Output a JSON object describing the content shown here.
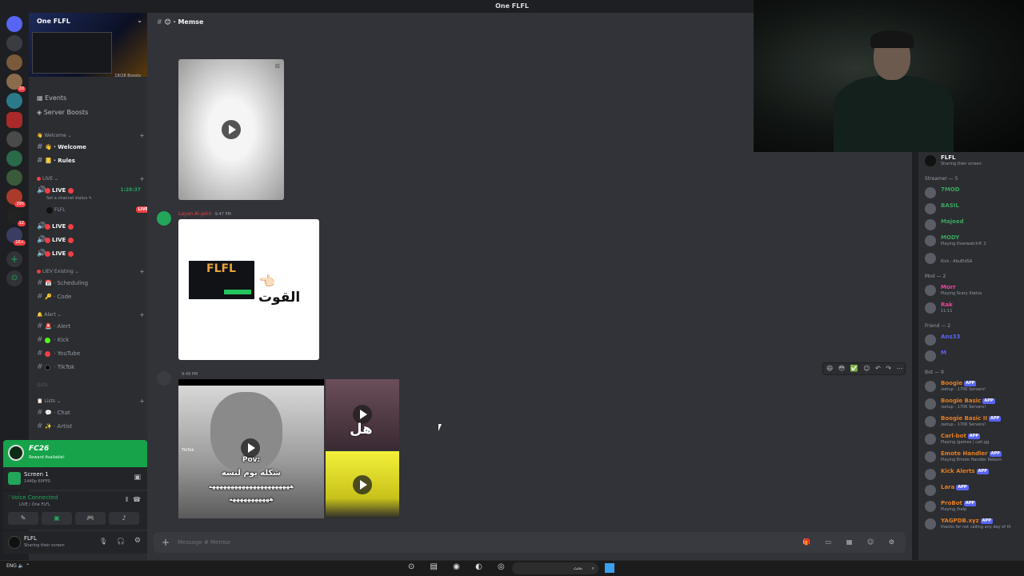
{
  "window": {
    "title": "One FLFL"
  },
  "guild_badges": [
    "",
    "",
    "20",
    "",
    "",
    "",
    "",
    "",
    "",
    "",
    "395",
    "12",
    "1K+"
  ],
  "server": {
    "name": "One FLFL",
    "boosts": "18/28 Boosts",
    "nav": [
      {
        "label": "Events",
        "icon": "calendar-icon"
      },
      {
        "label": "Server Boosts",
        "icon": "boost-icon"
      }
    ],
    "categories": {
      "welcome": "Welcome",
      "live": "LIVE",
      "liev_existing": "LIEV Existing",
      "alert": "Alert",
      "lists": "Lists",
      "girls": "Girls"
    },
    "channels": {
      "welcome": "Welcome",
      "rules": "Rules",
      "live_main": "LIVE",
      "live_status": "Set a channel status",
      "live_timer": "1:28:37",
      "live_user": "FLFL",
      "live_badge": "LIVE",
      "live_2": "LIVE",
      "live_3": "LIVE",
      "live_4": "LIVE",
      "scheduling": "Scheduling",
      "code": "Code",
      "alert": "Alert",
      "kick": "Kick",
      "youtube": "YouTube",
      "tiktok": "TikTok",
      "chat": "Chat",
      "artist": "Artist"
    }
  },
  "panels": {
    "fc_title": "FC26",
    "fc_sub": "Reward Available!",
    "screen_title": "Screen 1",
    "screen_sub": "1440p 60FPS",
    "voice_title": "Voice Connected",
    "voice_sub": "LIVE / One FLFL",
    "user_name": "FLFL",
    "user_status": "Sharing their screen"
  },
  "main": {
    "channel_name": "Memse",
    "messages": [
      {
        "author": "Layan Al-Jahri",
        "time": "9:47 PM"
      },
      {
        "author": "",
        "time": "9:49 PM"
      }
    ],
    "image_text": "القوت",
    "image_logo": "FLFL",
    "tiktok": {
      "watermark": "TikTok",
      "pov": "Pov:",
      "line1": "شكله يوم لبسه",
      "line2": "ههههههههههههههههههههههه",
      "line3": "هههههههههههه",
      "side_text": "هل"
    },
    "reaction_icons": "😄 😳 ✅ ☺ ↶ ↷ ⋯",
    "composer_placeholder": "Message # Memse",
    "composer_icons": "🎁 ▭ ▦ ☺ ⚙"
  },
  "members": {
    "top": {
      "name": "FLFL",
      "status": "Sharing their screen"
    },
    "groups": [
      {
        "header": "Streamer — 5",
        "items": [
          {
            "name": "7MOD",
            "status": "",
            "color": "#3ba55c"
          },
          {
            "name": "BASIL",
            "status": "",
            "color": "#3ba55c"
          },
          {
            "name": "Majeed",
            "status": "",
            "color": "#3ba55c"
          },
          {
            "name": "MODY",
            "status": "Playing Overwatch® 2",
            "color": "#3ba55c"
          },
          {
            "name": "",
            "status": "Kick : AbuEldSA",
            "color": "#3ba55c"
          }
        ]
      },
      {
        "header": "Mod — 2",
        "items": [
          {
            "name": "Morr",
            "status": "Playing Scary Status",
            "color": "#eb459e"
          },
          {
            "name": "Rak",
            "status": "11:11",
            "color": "#eb459e"
          }
        ]
      },
      {
        "header": "Friend — 2",
        "items": [
          {
            "name": "Ans33",
            "status": "",
            "color": "#5865f2"
          },
          {
            "name": "M",
            "status": "",
            "color": "#5865f2"
          }
        ]
      },
      {
        "header": "Bot — 9",
        "items": [
          {
            "name": "Boogie",
            "status": "/setup - 170K Servers!",
            "color": "#e67e22",
            "app": "APP"
          },
          {
            "name": "Boogie Basic",
            "status": "/setup - 170K Servers!",
            "color": "#e67e22",
            "app": "APP"
          },
          {
            "name": "Boogie Basic II",
            "status": "/setup - 170K Servers!",
            "color": "#e67e22",
            "app": "APP"
          },
          {
            "name": "Carl-bot",
            "status": "Playing /games | carl.gg",
            "color": "#e67e22",
            "app": "APP"
          },
          {
            "name": "Emote Handler",
            "status": "Playing Emote Handler Reborn",
            "color": "#e67e22",
            "app": "APP"
          },
          {
            "name": "Kick Alerts",
            "status": "",
            "color": "#e67e22",
            "app": "APP"
          },
          {
            "name": "Lara",
            "status": "",
            "color": "#e67e22",
            "app": "APP"
          },
          {
            "name": "ProBot",
            "status": "Playing /help",
            "color": "#e67e22",
            "app": "APP"
          },
          {
            "name": "YAGPDB.xyz",
            "status": "thanks for not calling any day of th",
            "color": "#e67e22",
            "app": "APP"
          }
        ]
      }
    ]
  },
  "taskbar": {
    "left": "ENG",
    "search_placeholder": "بحث",
    "icons": "⊙ ▤ ◉ ◐ ◎ ▣"
  }
}
